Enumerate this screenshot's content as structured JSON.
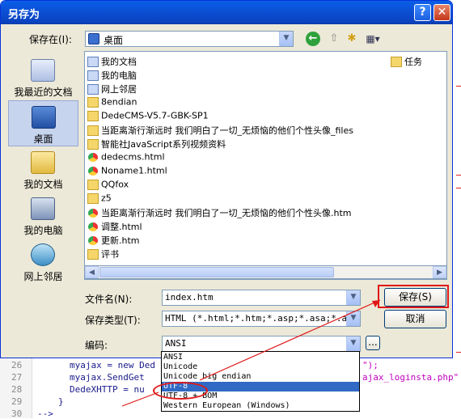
{
  "dialog": {
    "title": "另存为",
    "help_symbol": "?",
    "close_symbol": "✕"
  },
  "location": {
    "label": "保存在(I):",
    "value": "桌面"
  },
  "toolbar": {
    "back_icon": "back-icon",
    "up_icon": "up-folder-icon",
    "new_folder_icon": "new-folder-icon",
    "views_icon": "views-menu-icon"
  },
  "places": [
    {
      "label": "我最近的文档",
      "icon": "recent-documents-icon"
    },
    {
      "label": "桌面",
      "icon": "desktop-icon"
    },
    {
      "label": "我的文档",
      "icon": "my-documents-icon"
    },
    {
      "label": "我的电脑",
      "icon": "my-computer-icon"
    },
    {
      "label": "网上邻居",
      "icon": "network-places-icon"
    }
  ],
  "files": [
    {
      "name": "我的文档",
      "type": "folder-sys"
    },
    {
      "name": "我的电脑",
      "type": "folder-sys"
    },
    {
      "name": "网上邻居",
      "type": "folder-sys"
    },
    {
      "name": "8endian",
      "type": "folder"
    },
    {
      "name": "DedeCMS-V5.7-GBK-SP1",
      "type": "folder"
    },
    {
      "name": "当距离渐行渐远时 我们明白了一切_无烦恼的他们个性头像_files",
      "type": "folder"
    },
    {
      "name": "智能社JavaScript系列视频资料",
      "type": "folder"
    },
    {
      "name": "dedecms.html",
      "type": "chrome"
    },
    {
      "name": "Noname1.html",
      "type": "chrome"
    },
    {
      "name": "QQfox",
      "type": "shortcut"
    },
    {
      "name": "z5",
      "type": "shortcut"
    },
    {
      "name": "当距离渐行渐远时 我们明白了一切_无烦恼的他们个性头像.htm",
      "type": "chrome"
    },
    {
      "name": "调整.html",
      "type": "chrome"
    },
    {
      "name": "更新.htm",
      "type": "chrome"
    },
    {
      "name": "评书",
      "type": "shortcut"
    }
  ],
  "files_right": [
    {
      "name": "任务",
      "type": "shortcut"
    }
  ],
  "filename": {
    "label": "文件名(N):",
    "value": "index.htm"
  },
  "filetype": {
    "label": "保存类型(T):",
    "value": "HTML (*.html;*.htm;*.asp;*.asa;*.aspx"
  },
  "encoding": {
    "label": "编码:",
    "value": "ANSI",
    "more_label": "...",
    "options": [
      "ANSI",
      "Unicode",
      "Unicode big endian",
      "UTF-8",
      "UTF-8 + BOM",
      "Western European (Windows)"
    ],
    "selected_index": 3
  },
  "buttons": {
    "save": "保存(S)",
    "cancel": "取消"
  },
  "editor": {
    "line_numbers": [
      "26",
      "27",
      "28",
      "29",
      "30"
    ],
    "lines": [
      "myajax = new Ded",
      "myajax.SendGet",
      "DedeXHTTP = nu",
      "}",
      "-->"
    ],
    "line26_tail": "\");",
    "line27_tail": "ajax_loginsta.php\""
  }
}
